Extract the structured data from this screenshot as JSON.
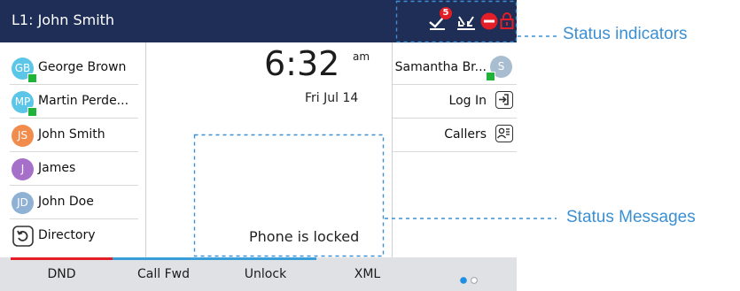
{
  "header": {
    "line_title": "L1: John Smith",
    "missed_calls_badge": "5",
    "status_icons": [
      "missed-calls-icon",
      "call-forward-icon",
      "do-not-disturb-icon",
      "lock-icon"
    ],
    "background": "#1f2e57"
  },
  "contacts": [
    {
      "initials": "GB",
      "name": "George Brown",
      "avatar_color": "#5bc6e8",
      "presence": true
    },
    {
      "initials": "MP",
      "name": "Martin Perde...",
      "avatar_color": "#5bc6e8",
      "presence": true
    },
    {
      "initials": "JS",
      "name": "John Smith",
      "avatar_color": "#f28c4c",
      "presence": false
    },
    {
      "initials": "J",
      "name": "James",
      "avatar_color": "#a66fc9",
      "presence": false
    },
    {
      "initials": "JD",
      "name": "John Doe",
      "avatar_color": "#8fb1d4",
      "presence": false
    },
    {
      "icon": "directory-icon",
      "name": "Directory"
    }
  ],
  "clock": {
    "time": "6:32",
    "ampm": "am",
    "date": "Fri Jul 14"
  },
  "status_message": "Phone is locked",
  "right_keys": [
    {
      "label": "Samantha Br...",
      "initials": "S",
      "avatar_color": "#a9bdd0",
      "presence": true
    },
    {
      "label": "Log In",
      "icon": "login-icon"
    },
    {
      "label": "Callers",
      "icon": "callers-icon"
    }
  ],
  "softkeys": [
    {
      "label": "DND",
      "bar_color": "#e41e26"
    },
    {
      "label": "Call Fwd",
      "bar_color": "#3a9fd8"
    },
    {
      "label": "Unlock",
      "bar_color": "#3a9fd8"
    },
    {
      "label": "XML",
      "bar_color": ""
    }
  ],
  "pager": {
    "active_color": "#1e8fe3",
    "pages": 2,
    "current": 1
  },
  "callouts": {
    "status_indicators": "Status indicators",
    "status_messages": "Status Messages",
    "color": "#3b8fd3"
  }
}
